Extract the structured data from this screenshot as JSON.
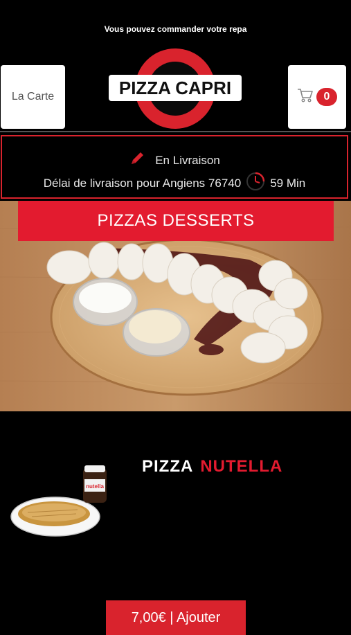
{
  "banner": {
    "text": "Vous pouvez commander votre repa"
  },
  "header": {
    "menu_label": "La Carte",
    "logo_text": "PIZZA CAPRI",
    "cart_count": "0"
  },
  "delivery": {
    "mode": "En Livraison",
    "info": "Délai de livraison pour Angiens 76740",
    "time": "59 Min"
  },
  "category": {
    "title": "PIZZAS DESSERTS"
  },
  "product": {
    "title_word1": "PIZZA",
    "title_word2": "NUTELLA",
    "jar_label": "nutella",
    "add_label": "7,00€ | Ajouter"
  },
  "colors": {
    "accent": "#d9232d",
    "background": "#000000"
  },
  "icons": {
    "cart": "cart-icon",
    "edit": "pencil-icon",
    "clock": "clock-icon"
  }
}
